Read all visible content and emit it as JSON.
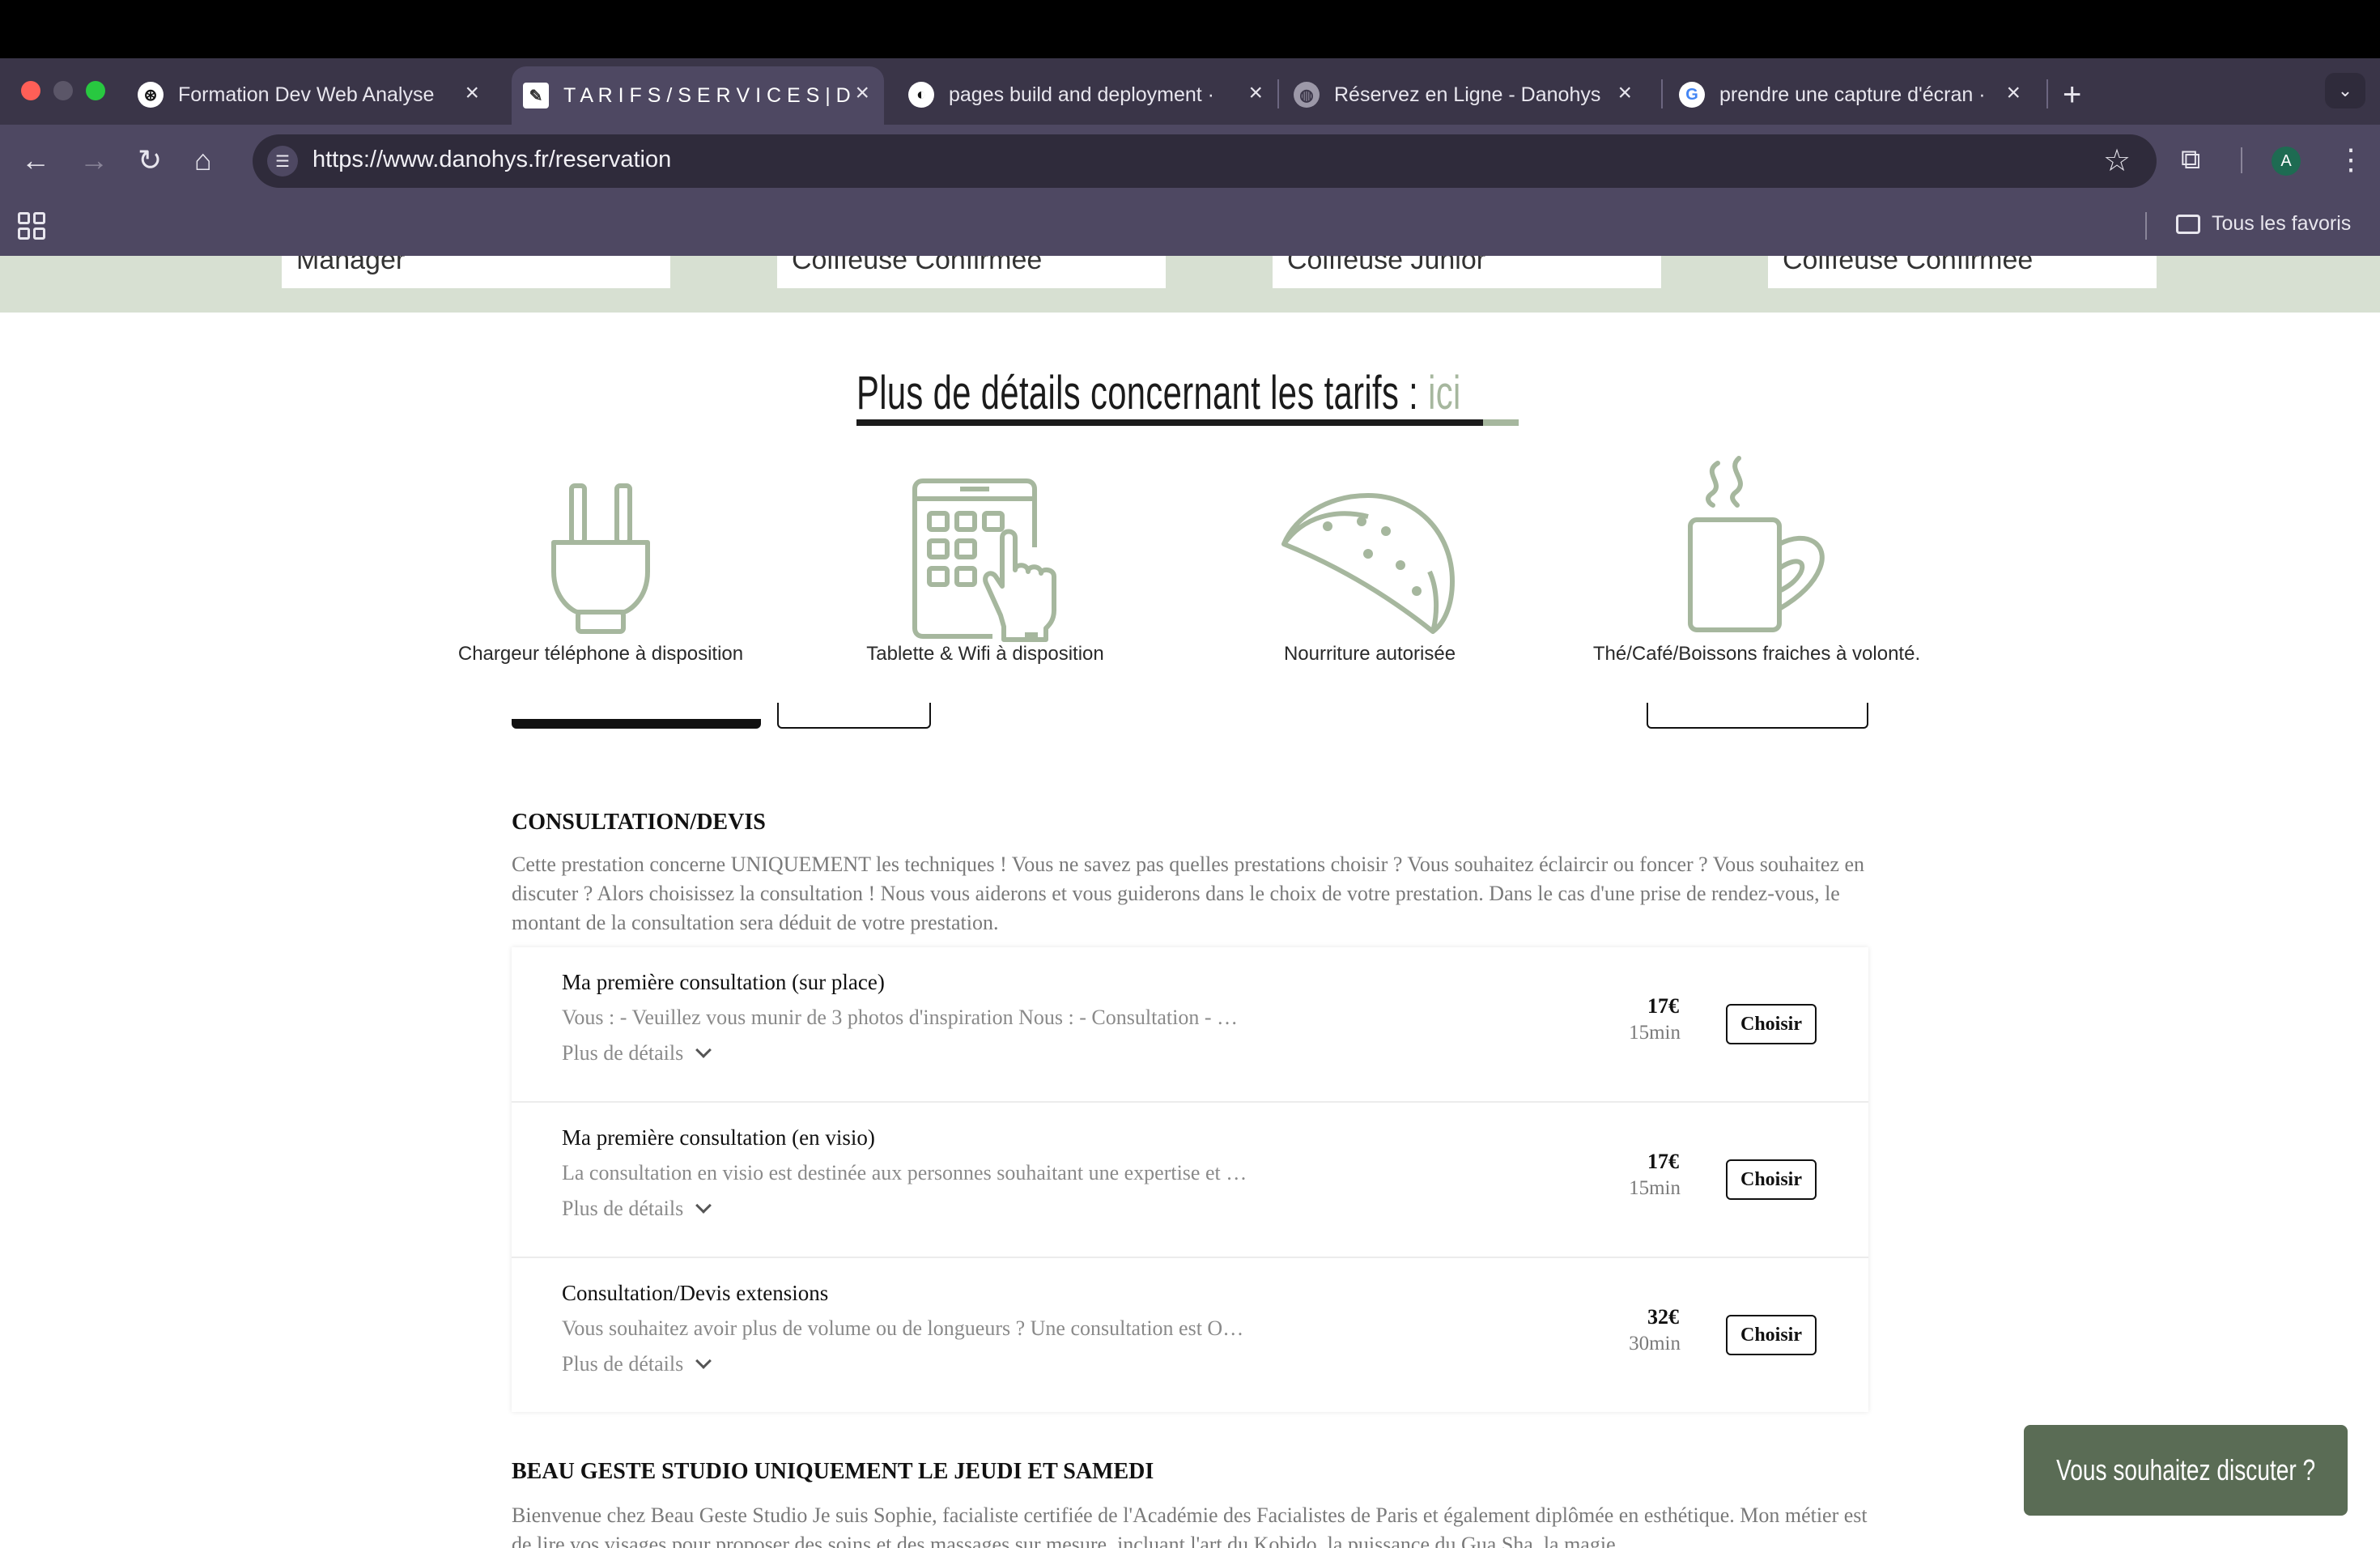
{
  "browser": {
    "tabs": [
      {
        "title": "Formation Dev Web Analyse",
        "favicon": "openai-icon"
      },
      {
        "title": "T A R I F S / S E R V I C E S | D",
        "favicon": "brush-icon"
      },
      {
        "title": "pages build and deployment ·",
        "favicon": "github-icon"
      },
      {
        "title": "Réservez en Ligne - Danohys",
        "favicon": "globe-icon"
      },
      {
        "title": "prendre une capture d'écran ·",
        "favicon": "google-icon"
      }
    ],
    "new_tab": "+",
    "url": "https://www.danohys.fr/reservation",
    "profile_initial": "A",
    "bookmarks_folder": "Tous les favoris"
  },
  "staff": [
    "Manager",
    "Coiffeuse Confirmée",
    "Coiffeuse Junior",
    "Coiffeuse Confirmée"
  ],
  "tarifs": {
    "heading": "Plus de détails concernant les tarifs : ",
    "link": "ici"
  },
  "amenities": [
    {
      "label": "Chargeur téléphone à disposition",
      "icon": "plug-icon"
    },
    {
      "label": "Tablette & Wifi à disposition",
      "icon": "tablet-icon"
    },
    {
      "label": "Nourriture autorisée",
      "icon": "taco-icon"
    },
    {
      "label": "Thé/Café/Boissons fraiches à volonté.",
      "icon": "coffee-mug-icon"
    }
  ],
  "consultation": {
    "title": "CONSULTATION/DEVIS",
    "description": "Cette prestation concerne UNIQUEMENT les techniques ! Vous ne savez pas quelles prestations choisir ? Vous souhaitez éclaircir ou foncer ? Vous souhaitez en discuter ? Alors choisissez la consultation ! Nous vous aiderons et vous guiderons dans le choix de votre prestation. Dans le cas d'une prise de rendez-vous, le montant de la consultation sera déduit de votre prestation.",
    "services": [
      {
        "name": "Ma première consultation (sur place)",
        "desc": "Vous : - Veuillez vous munir de 3 photos d'inspiration Nous : - Consultation - …",
        "more": "Plus de détails",
        "price": "17€",
        "duration": "15min",
        "button": "Choisir"
      },
      {
        "name": "Ma première consultation (en visio)",
        "desc": "La consultation en visio est destinée aux personnes souhaitant une expertise et …",
        "more": "Plus de détails",
        "price": "17€",
        "duration": "15min",
        "button": "Choisir"
      },
      {
        "name": "Consultation/Devis extensions",
        "desc": "Vous souhaitez avoir plus de volume ou de longueurs ? Une consultation est O…",
        "more": "Plus de détails",
        "price": "32€",
        "duration": "30min",
        "button": "Choisir"
      }
    ]
  },
  "beau_geste": {
    "title": "BEAU GESTE STUDIO UNIQUEMENT LE JEUDI ET SAMEDI",
    "description": "Bienvenue chez Beau Geste Studio Je suis Sophie, facialiste certifiée de l'Académie des Facialistes de Paris et également diplômée en esthétique. Mon métier est de lire vos visages pour proposer des soins et des massages sur mesure, incluant l'art du Kobido, la puissance du Gua Sha, la magie"
  },
  "chat": {
    "label": "Vous souhaitez discuter ?"
  },
  "colors": {
    "accent_green": "#a6b79e",
    "band_green": "#d7e0d2",
    "chat_green": "#5a6c55",
    "chrome": "#4e4862"
  }
}
